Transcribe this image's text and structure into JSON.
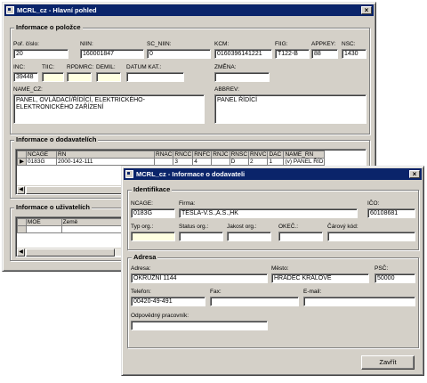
{
  "main": {
    "title": "MCRL_cz - Hlavní pohled",
    "item_group": {
      "title": "Informace o položce",
      "por_cislo": {
        "label": "Poř. číslo:",
        "value": "20"
      },
      "niin": {
        "label": "NIIN:",
        "value": "160001847"
      },
      "sc_niin": {
        "label": "SC_NIIN:",
        "value": "0"
      },
      "kcm": {
        "label": "KCM:",
        "value": "0160396141221"
      },
      "fiig": {
        "label": "FIIG:",
        "value": "T122-B"
      },
      "appkey": {
        "label": "APPKEY:",
        "value": "88"
      },
      "nsc": {
        "label": "NSC:",
        "value": "1430"
      },
      "inc": {
        "label": "INC:",
        "value": "39448"
      },
      "tiic": {
        "label": "TIIC:",
        "value": ""
      },
      "rpdmrc": {
        "label": "RPDMRC:",
        "value": ""
      },
      "demil": {
        "label": "DEMIL:",
        "value": ""
      },
      "datum_kat": {
        "label": "DATUM KAT.:",
        "value": ""
      },
      "zmena": {
        "label": "ZMĚNA:",
        "value": ""
      },
      "name_cz": {
        "label": "NAME_CZ:",
        "value": "PANEL, OVLÁDACÍ/ŘÍDÍCÍ, ELEKTRICKÉHO-ELEKTRONICKÉHO ZAŘÍZENÍ"
      },
      "abbrev": {
        "label": "ABBREV:",
        "value": "PANEL ŘÍDÍCÍ"
      }
    },
    "supplier_group": {
      "title": "Informace o dodavatelích",
      "columns": [
        "",
        "NCAGE",
        "RN",
        "RNAC",
        "RNCC",
        "RNFC",
        "RNJC",
        "RNSC",
        "RNVC",
        "DAC",
        "NAME_RN"
      ],
      "rows": [
        {
          "marker": "▶",
          "cells": [
            "0183G",
            "2000-142-111",
            "",
            "3",
            "4",
            "",
            "D",
            "2",
            "1",
            "(v) PANEL ŘÍD"
          ]
        }
      ]
    },
    "user_group": {
      "title": "Informace o uživatelích",
      "columns": [
        "",
        "MOE",
        "Země"
      ]
    }
  },
  "dialog": {
    "title": "MCRL_cz - Informace o dodavateli",
    "ident": {
      "title": "Identifikace",
      "ncage": {
        "label": "NCAGE:",
        "value": "0183G"
      },
      "firma": {
        "label": "Firma:",
        "value": "TESLA-V.S.,A.S.,HK"
      },
      "ico": {
        "label": "IČO:",
        "value": "60108681"
      },
      "typ_org": {
        "label": "Typ org.:",
        "value": ""
      },
      "status_org": {
        "label": "Status org.:",
        "value": ""
      },
      "jakost_org": {
        "label": "Jakost org.:",
        "value": ""
      },
      "okec": {
        "label": "OKEČ.:",
        "value": ""
      },
      "carovy_kod": {
        "label": "Čárový kód:",
        "value": ""
      }
    },
    "address": {
      "title": "Adresa",
      "adresa": {
        "label": "Adresa:",
        "value": "OKRUŽNÍ 1144"
      },
      "mesto": {
        "label": "Město:",
        "value": "HRADEC KRÁLOVÉ"
      },
      "psc": {
        "label": "PSČ:",
        "value": "50000"
      },
      "telefon": {
        "label": "Telefon:",
        "value": "00420-49-491"
      },
      "fax": {
        "label": "Fax:",
        "value": ""
      },
      "email": {
        "label": "E-mail:",
        "value": ""
      },
      "pracovnik": {
        "label": "Odpovědný pracovník:",
        "value": ""
      }
    },
    "close_label": "Zavřít"
  },
  "icons": {
    "close": "close-icon",
    "app": "app-window-icon",
    "row_marker": "row-pointer-icon"
  }
}
